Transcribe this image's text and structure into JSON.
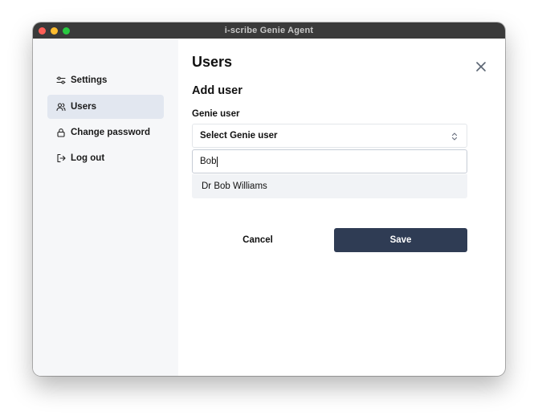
{
  "window": {
    "title": "i-scribe Genie Agent"
  },
  "sidebar": {
    "items": [
      {
        "label": "Settings",
        "icon": "sliders-icon",
        "active": false
      },
      {
        "label": "Users",
        "icon": "users-icon",
        "active": true
      },
      {
        "label": "Change password",
        "icon": "lock-icon",
        "active": false
      },
      {
        "label": "Log out",
        "icon": "logout-icon",
        "active": false
      }
    ]
  },
  "main": {
    "title": "Users",
    "section_title": "Add user",
    "field_label": "Genie user",
    "select_value": "Select Genie user",
    "search_value": "Bob",
    "options": [
      "Dr Bob Williams"
    ],
    "cancel_label": "Cancel",
    "save_label": "Save"
  },
  "colors": {
    "titlebar": "#3a3a3a",
    "sidebar_bg": "#f6f7f9",
    "active_item": "#e2e7f0",
    "save_button": "#2f3c54"
  }
}
